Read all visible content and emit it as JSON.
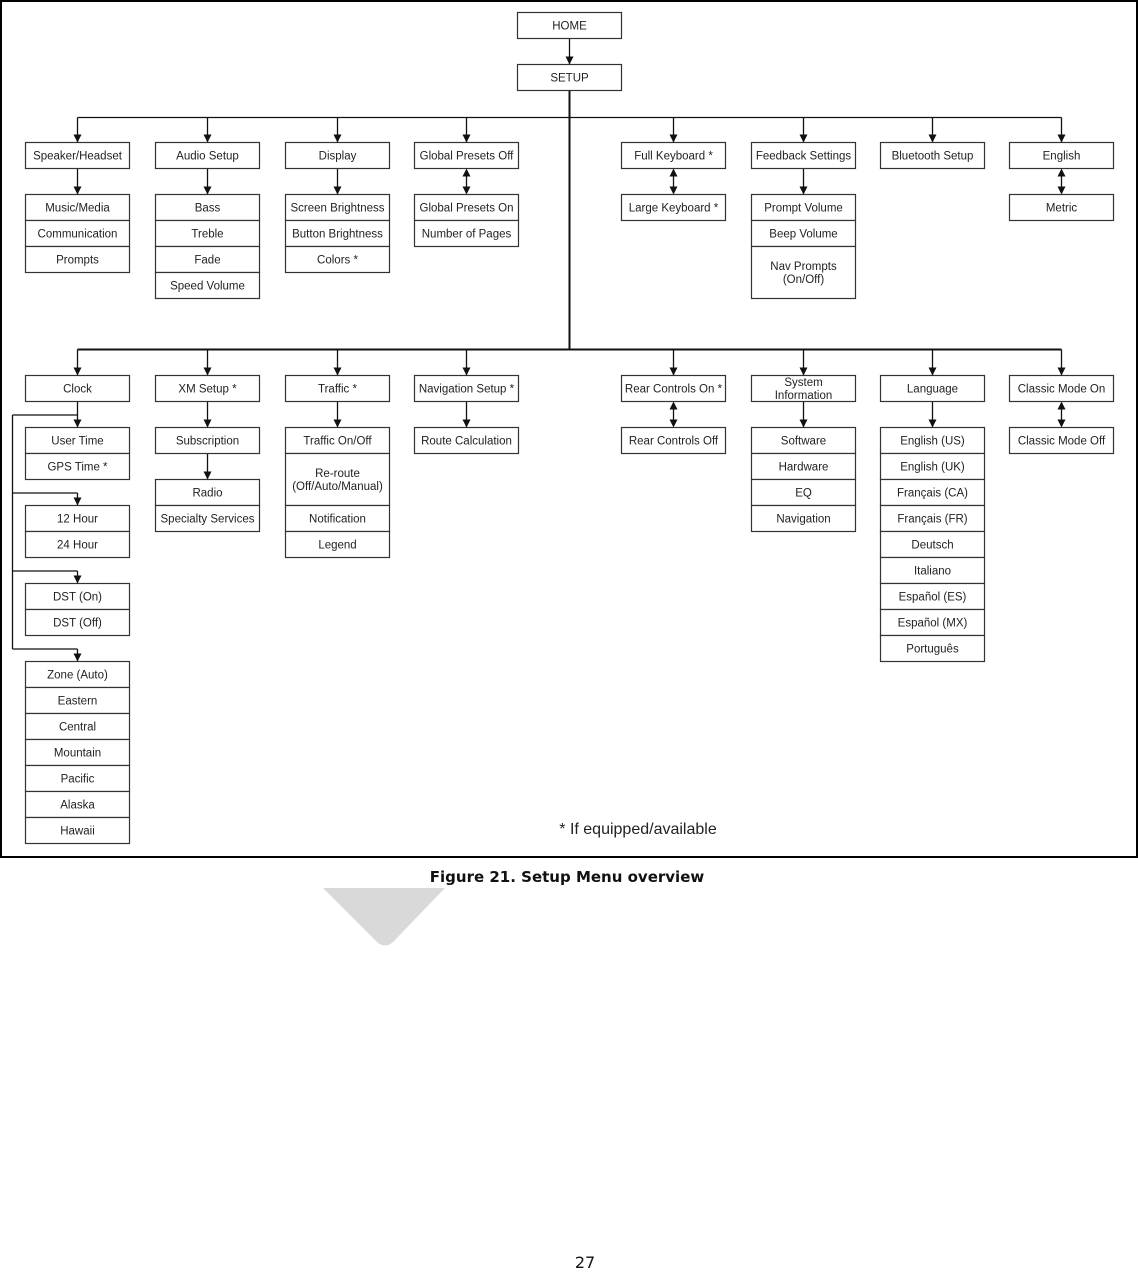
{
  "figure": {
    "caption": "Figure 21. Setup Menu overview",
    "footnote": "* If equipped/available",
    "page_number": "27"
  },
  "diagram": {
    "root": "HOME",
    "setup": "SETUP",
    "top_row": [
      {
        "id": "speaker",
        "label": "Speaker/Headset",
        "link": "arrow",
        "children": [
          "Music/Media",
          "Communication",
          "Prompts"
        ]
      },
      {
        "id": "audio",
        "label": "Audio Setup",
        "link": "arrow",
        "children": [
          "Bass",
          "Treble",
          "Fade",
          "Speed Volume"
        ]
      },
      {
        "id": "display",
        "label": "Display",
        "link": "arrow",
        "children": [
          "Screen Brightness",
          "Button Brightness",
          "Colors *"
        ]
      },
      {
        "id": "global-presets",
        "label": "Global Presets Off",
        "link": "toggle",
        "children": [
          "Global Presets On",
          "Number of Pages"
        ]
      },
      {
        "id": "keyboard",
        "label": "Full Keyboard *",
        "link": "toggle",
        "children": [
          "Large Keyboard *"
        ]
      },
      {
        "id": "feedback",
        "label": "Feedback Settings",
        "link": "arrow",
        "children": [
          "Prompt Volume",
          "Beep Volume",
          "Nav Prompts\n(On/Off)"
        ]
      },
      {
        "id": "bluetooth",
        "label": "Bluetooth Setup",
        "link": "none",
        "children": []
      },
      {
        "id": "units",
        "label": "English",
        "link": "toggle",
        "children": [
          "Metric"
        ]
      }
    ],
    "bottom_row": [
      {
        "id": "clock",
        "label": "Clock",
        "link": "branch",
        "groups": [
          [
            "User Time",
            "GPS Time *"
          ],
          [
            "12 Hour",
            "24 Hour"
          ],
          [
            "DST (On)",
            "DST (Off)"
          ],
          [
            "Zone (Auto)",
            "Eastern",
            "Central",
            "Mountain",
            "Pacific",
            "Alaska",
            "Hawaii"
          ]
        ]
      },
      {
        "id": "xm",
        "label": "XM Setup *",
        "link": "arrow",
        "children": [
          "Subscription"
        ],
        "sub": {
          "children": [
            "Radio",
            "Specialty Services"
          ]
        }
      },
      {
        "id": "traffic",
        "label": "Traffic *",
        "link": "arrow",
        "children": [
          "Traffic On/Off",
          "Re-route\n(Off/Auto/Manual)",
          "Notification",
          "Legend"
        ]
      },
      {
        "id": "navigation",
        "label": "Navigation Setup *",
        "link": "arrow",
        "children": [
          "Route Calculation"
        ]
      },
      {
        "id": "rear-controls",
        "label": "Rear Controls On *",
        "link": "toggle",
        "children": [
          "Rear Controls Off"
        ]
      },
      {
        "id": "system-info",
        "label": "System\nInformation",
        "link": "arrow",
        "children": [
          "Software",
          "Hardware",
          "EQ",
          "Navigation"
        ]
      },
      {
        "id": "language",
        "label": "Language",
        "link": "arrow",
        "children": [
          "English (US)",
          "English (UK)",
          "Français (CA)",
          "Français (FR)",
          "Deutsch",
          "Italiano",
          "Español (ES)",
          "Español (MX)",
          "Português"
        ]
      },
      {
        "id": "classic-mode",
        "label": "Classic Mode On",
        "link": "toggle",
        "children": [
          "Classic Mode Off"
        ]
      }
    ]
  }
}
